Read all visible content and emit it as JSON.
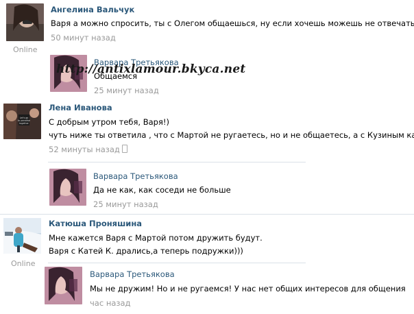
{
  "watermark": "http://antixlamour.bkyca.net",
  "comments": [
    {
      "author": "Ангелина Вальчук",
      "lines": [
        "Варя а можно спросить, ты с Олегом общаешься, ну если хочешь можешь не отвечать!!!"
      ],
      "time": "50 минут назад",
      "status": "Online",
      "reply": {
        "author": "Варвара Третьякова",
        "lines": [
          "Общаемся"
        ],
        "time": "25 минут назад"
      }
    },
    {
      "author": "Лена Иванова",
      "lines": [
        "С добрым утром тебя, Варя!)",
        "чуть ниже ты ответила , что с Мартой не ругаетесь, но и не общаетесь, а с Кузиным как?))"
      ],
      "time": "52 минуты назад",
      "time_icon": "mobile-phone-icon",
      "avatar_text": "Let's go to paradise together",
      "reply": {
        "author": "Варвара Третьякова",
        "lines": [
          "Да не как, как соседи не больше"
        ],
        "time": "25 минут назад"
      }
    },
    {
      "author": "Катюша Проняшина",
      "lines": [
        "Мне кажется Варя с Мартой потом дружить будут.",
        "Варя с Катей К. дрались,а теперь подружки)))"
      ],
      "status": "Online",
      "reply": {
        "author": "Варвара Третьякова",
        "lines": [
          "Мы не дружим! Но и не ругаемся! У нас нет общих интересов для общения"
        ],
        "time": "час назад"
      }
    }
  ],
  "colors": {
    "author": "#2b587a",
    "time": "#999999",
    "divider": "#dae1e8"
  }
}
